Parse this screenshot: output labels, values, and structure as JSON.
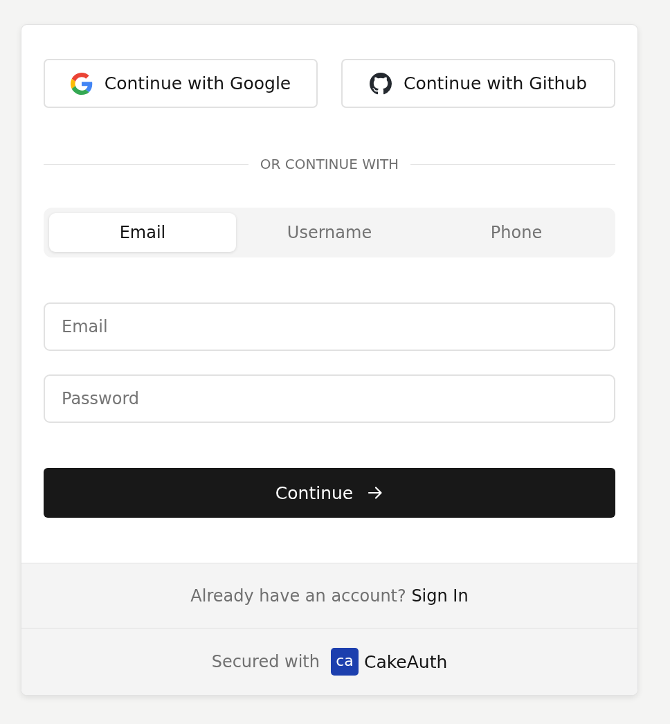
{
  "social_buttons": [
    {
      "kind": "google",
      "label": "Continue with Google"
    },
    {
      "kind": "github",
      "label": "Continue with Github"
    }
  ],
  "divider": {
    "label": "OR CONTINUE WITH"
  },
  "tabs": [
    {
      "label": "Email",
      "selected": true
    },
    {
      "label": "Username",
      "selected": false
    },
    {
      "label": "Phone",
      "selected": false
    }
  ],
  "fields": [
    {
      "placeholder": "Email"
    },
    {
      "placeholder": "Password"
    }
  ],
  "submit": {
    "label": "Continue"
  },
  "signin_prompt": {
    "text": "Already have an account?",
    "link": "Sign In"
  },
  "footer": {
    "text": "Secured with",
    "logo_text": "ca",
    "brand": "CakeAuth"
  }
}
